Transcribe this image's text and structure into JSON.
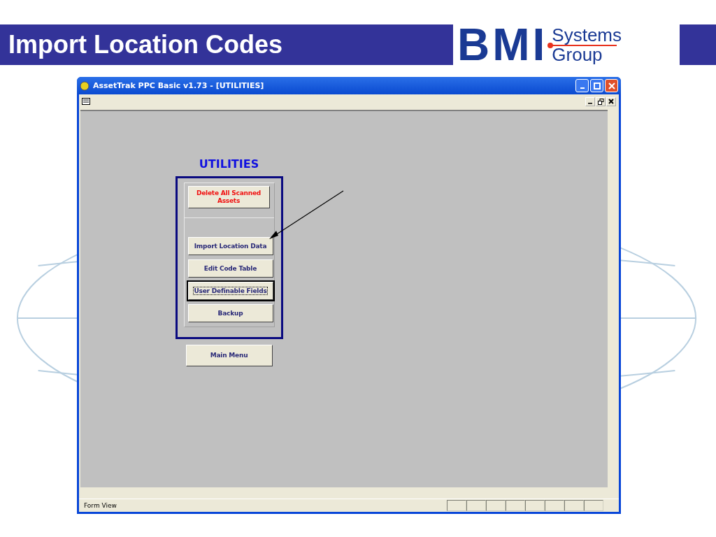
{
  "slide": {
    "title": "Import Location Codes"
  },
  "logo": {
    "mark": "BMI",
    "line1": "Systems",
    "line2": "Group"
  },
  "window": {
    "title": "AssetTrak PPC Basic v1.73 - [UTILITIES]"
  },
  "form": {
    "heading": "UTILITIES",
    "top_buttons": [
      {
        "label": "Delete All Scanned Assets",
        "kind": "danger",
        "focused": false
      }
    ],
    "buttons": [
      {
        "label": "Import Location Data",
        "kind": "normal",
        "focused": false
      },
      {
        "label": "Edit Code Table",
        "kind": "normal",
        "focused": false
      },
      {
        "label": "User Definable Fields",
        "kind": "normal",
        "focused": true
      },
      {
        "label": "Backup",
        "kind": "normal",
        "focused": false
      }
    ],
    "bottom_button": {
      "label": "Main Menu",
      "kind": "normal",
      "focused": false
    }
  },
  "status_bar": {
    "text": "Form View"
  }
}
